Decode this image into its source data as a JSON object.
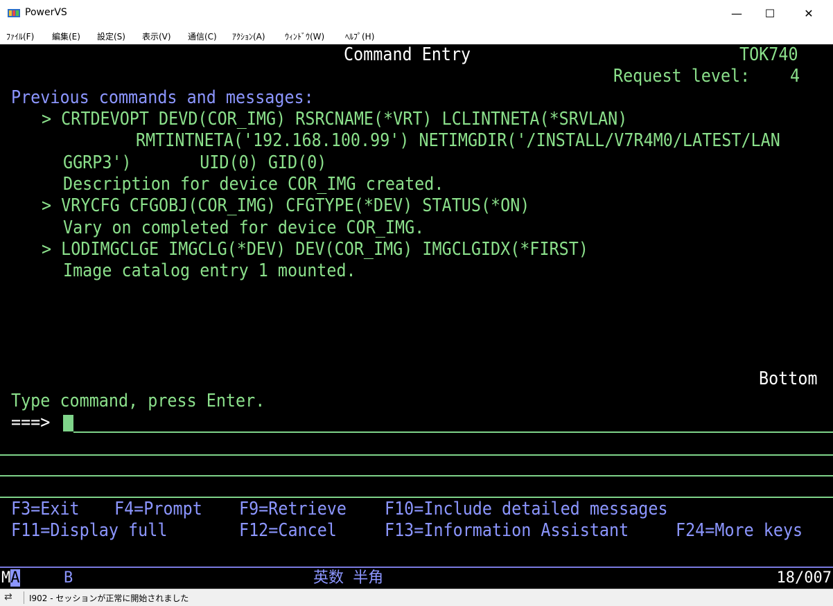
{
  "window": {
    "title": "PowerVS",
    "minimize": "—",
    "maximize": "☐",
    "close": "✕"
  },
  "menu": [
    {
      "label": "ﾌｧｲﾙ(F)"
    },
    {
      "label": "編集(E)"
    },
    {
      "label": "設定(S)"
    },
    {
      "label": "表示(V)"
    },
    {
      "label": "通信(C)"
    },
    {
      "label": "ｱｸｼｮﾝ(A)"
    },
    {
      "label": "ｳｨﾝﾄﾞｳ(W)"
    },
    {
      "label": "ﾍﾙﾌﾟ(H)"
    }
  ],
  "screen": {
    "title": "Command Entry",
    "system": "TOK740",
    "request_level_label": "Request level:",
    "request_level": "4",
    "section_label": "Previous commands and messages:",
    "lines": [
      "> CRTDEVOPT DEVD(COR_IMG) RSRCNAME(*VRT) LCLINTNETA(*SRVLAN)",
      "RMTINTNETA('192.168.100.99') NETIMGDIR('/INSTALL/V7R4M0/LATEST/LAN",
      "GGRP3')       UID(0) GID(0)",
      "Description for device COR_IMG created.",
      "> VRYCFG CFGOBJ(COR_IMG) CFGTYPE(*DEV) STATUS(*ON)",
      "Vary on completed for device COR_IMG.",
      "> LODIMGCLGE IMGCLG(*DEV) DEV(COR_IMG) IMGCLGIDX(*FIRST)",
      "Image catalog entry 1 mounted."
    ],
    "bottom_label": "Bottom",
    "prompt_text": "Type command, press Enter.",
    "prompt_arrow": "===>",
    "command_value": "",
    "fkeys_row1": [
      "F3=Exit",
      "F4=Prompt",
      "F9=Retrieve",
      "F10=Include detailed messages"
    ],
    "fkeys_row2": [
      "F11=Display full",
      "F12=Cancel",
      "F13=Information Assistant",
      "F24=More keys"
    ]
  },
  "oia": {
    "mode_prefix": "M",
    "mode_highlight": "A",
    "indicator": "B",
    "ime": "英数 半角",
    "cursor_pos": "18/007"
  },
  "status": {
    "message": "I902 - セッションが正常に開始されました"
  }
}
